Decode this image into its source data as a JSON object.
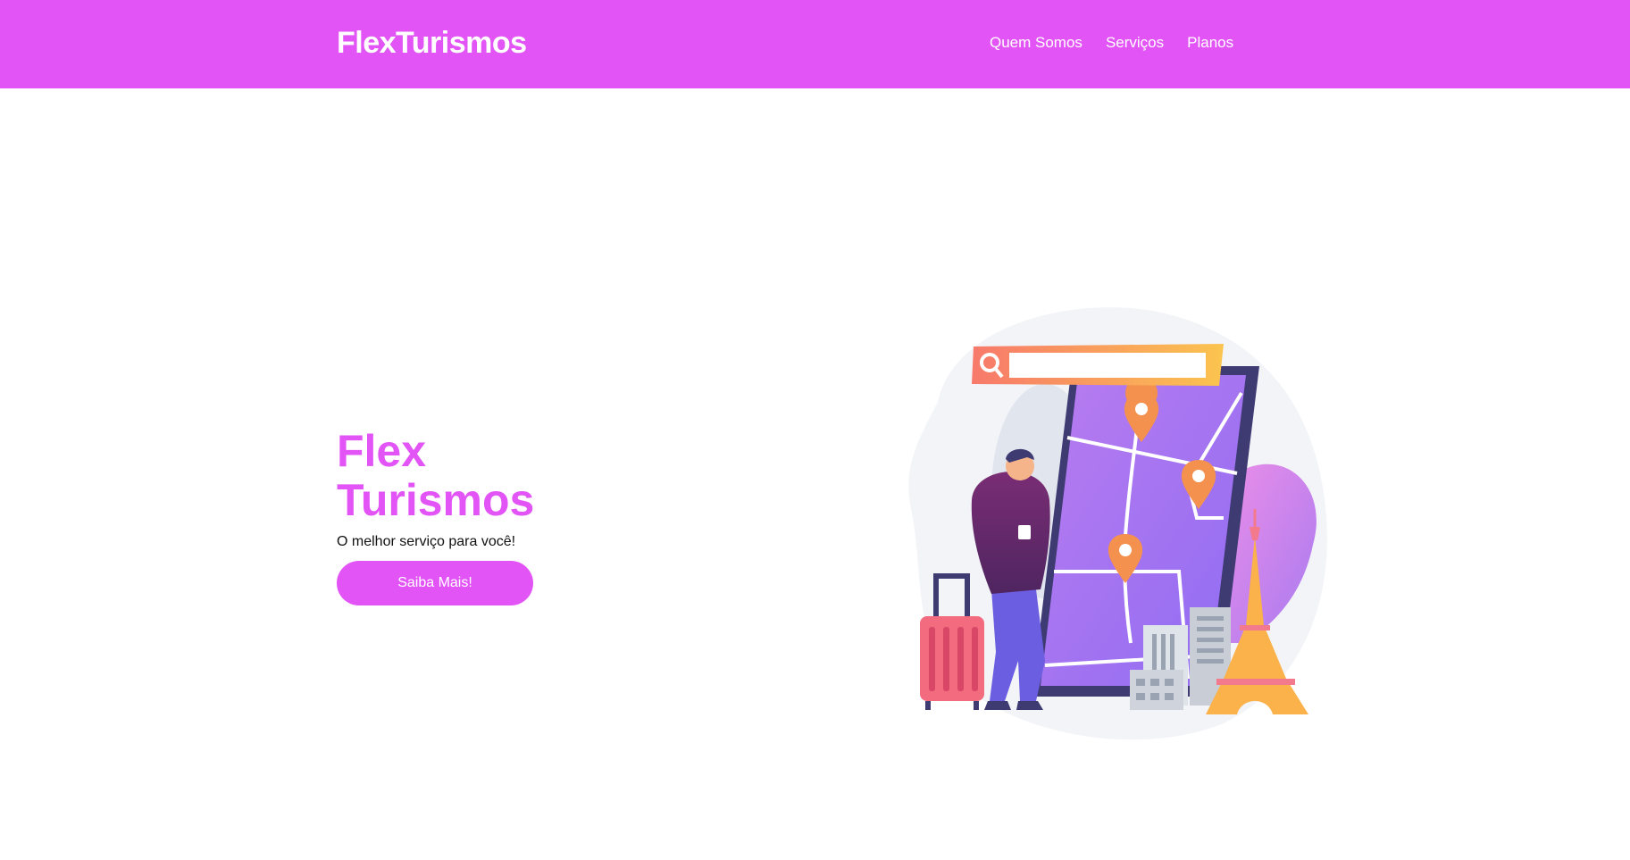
{
  "header": {
    "brand": "FlexTurismos",
    "nav": [
      {
        "label": "Quem Somos"
      },
      {
        "label": "Serviços"
      },
      {
        "label": "Planos"
      }
    ]
  },
  "hero": {
    "title": "Flex Turismos",
    "subtitle": "O melhor serviço para você!",
    "cta_label": "Saiba Mais!"
  },
  "illustration": {
    "icon": "travel-map-illustration"
  },
  "colors": {
    "accent": "#e254f6",
    "text": "#111111",
    "background": "#ffffff"
  }
}
